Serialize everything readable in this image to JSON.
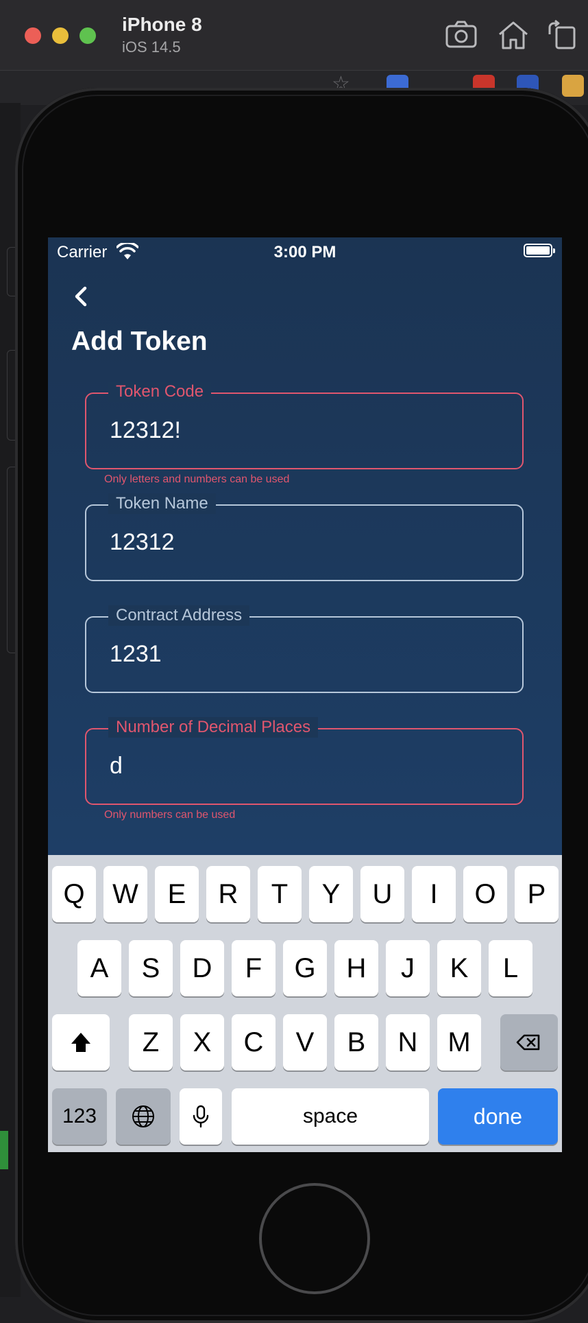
{
  "simulator": {
    "device_name": "iPhone 8",
    "os_version": "iOS 14.5",
    "toolbar_icons": [
      "screenshot-icon",
      "home-icon",
      "rotate-icon"
    ]
  },
  "status_bar": {
    "carrier": "Carrier",
    "time": "3:00 PM"
  },
  "page": {
    "title": "Add Token",
    "back_icon": "chevron-left-icon"
  },
  "form": {
    "fields": [
      {
        "label": "Token Code",
        "value": "12312!",
        "error": "Only letters and numbers can be used",
        "state": "error"
      },
      {
        "label": "Token Name",
        "value": "12312",
        "error": "",
        "state": "normal"
      },
      {
        "label": "Contract Address",
        "value": "1231",
        "error": "",
        "state": "normal"
      },
      {
        "label": "Number of Decimal Places",
        "value": "d",
        "error": "Only numbers can be used",
        "state": "error"
      }
    ]
  },
  "colors": {
    "error": "#e0566e",
    "field_border": "#b6c7da",
    "done_key": "#2f80ed"
  },
  "keyboard": {
    "row1": [
      "Q",
      "W",
      "E",
      "R",
      "T",
      "Y",
      "U",
      "I",
      "O",
      "P"
    ],
    "row2": [
      "A",
      "S",
      "D",
      "F",
      "G",
      "H",
      "J",
      "K",
      "L"
    ],
    "row3": [
      "Z",
      "X",
      "C",
      "V",
      "B",
      "N",
      "M"
    ],
    "numbers_key": "123",
    "space_key": "space",
    "done_key": "done"
  }
}
